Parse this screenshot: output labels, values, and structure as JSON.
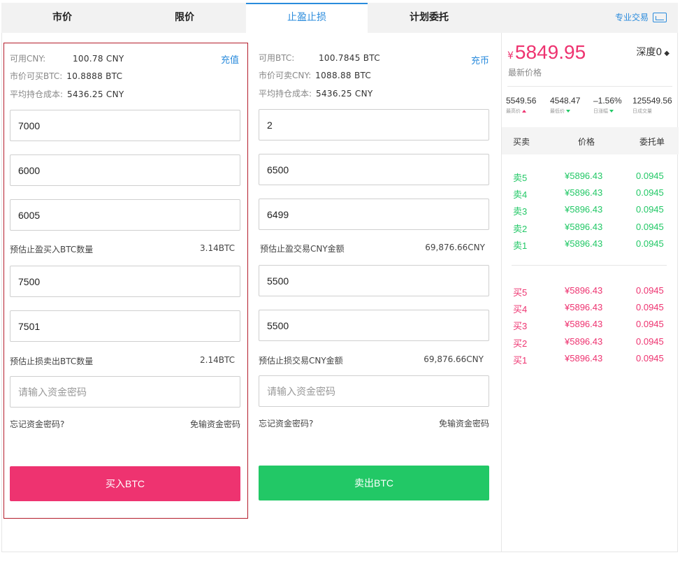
{
  "tabs": [
    {
      "label": "市价"
    },
    {
      "label": "限价"
    },
    {
      "label": "止盈止损"
    },
    {
      "label": "计划委托"
    }
  ],
  "pro_trade_label": "专业交易",
  "buy_panel": {
    "info": [
      {
        "label": "可用CNY:",
        "value": "100.78 CNY"
      },
      {
        "label": "市价可买BTC:",
        "value": "10.8888 BTC"
      },
      {
        "label": "平均持仓成本:",
        "value": "5436.25 CNY"
      }
    ],
    "topup_label": "充值",
    "fields": [
      "7000",
      "6000",
      "6005",
      "7500",
      "7501"
    ],
    "estimate_profit": {
      "label": "预估止盈买入BTC数量",
      "value": "3.14BTC"
    },
    "estimate_loss": {
      "label": "预估止损卖出BTC数量",
      "value": "2.14BTC"
    },
    "password_placeholder": "请输入资金密码",
    "forgot_label": "忘记资金密码?",
    "nopass_label": "免输资金密码",
    "action_label": "买入BTC"
  },
  "sell_panel": {
    "info": [
      {
        "label": "可用BTC:",
        "value": "100.7845 BTC"
      },
      {
        "label": "市价可卖CNY:",
        "value": "1088.88 BTC"
      },
      {
        "label": "平均持仓成本:",
        "value": "5436.25 CNY"
      }
    ],
    "topup_label": "充币",
    "fields": [
      "2",
      "6500",
      "6499",
      "5500",
      "5500"
    ],
    "estimate_profit": {
      "label": "预估止盈交易CNY金额",
      "value": "69,876.66CNY"
    },
    "estimate_loss": {
      "label": "预估止损交易CNY金额",
      "value": "69,876.66CNY"
    },
    "password_placeholder": "请输入资金密码",
    "forgot_label": "忘记资金密码?",
    "nopass_label": "免输资金密码",
    "action_label": "卖出BTC"
  },
  "market": {
    "currency_symbol": "¥",
    "last_price": "5849.95",
    "last_price_label": "最新价格",
    "depth_label": "深度0",
    "depth_arrows": "◆",
    "stats": [
      {
        "value": "5549.56",
        "label": "最高价"
      },
      {
        "value": "4548.47",
        "label": "最低价"
      },
      {
        "value": "–1.56%",
        "label": "日涨幅"
      },
      {
        "value": "125549.56",
        "label": "日成交量"
      }
    ],
    "book_headers": {
      "side": "买卖",
      "price": "价格",
      "qty": "委托单"
    },
    "asks": [
      {
        "side": "卖5",
        "price": "¥5896.43",
        "qty": "0.0945"
      },
      {
        "side": "卖4",
        "price": "¥5896.43",
        "qty": "0.0945"
      },
      {
        "side": "卖3",
        "price": "¥5896.43",
        "qty": "0.0945"
      },
      {
        "side": "卖2",
        "price": "¥5896.43",
        "qty": "0.0945"
      },
      {
        "side": "卖1",
        "price": "¥5896.43",
        "qty": "0.0945"
      }
    ],
    "bids": [
      {
        "side": "买5",
        "price": "¥5896.43",
        "qty": "0.0945"
      },
      {
        "side": "买4",
        "price": "¥5896.43",
        "qty": "0.0945"
      },
      {
        "side": "买3",
        "price": "¥5896.43",
        "qty": "0.0945"
      },
      {
        "side": "买2",
        "price": "¥5896.43",
        "qty": "0.0945"
      },
      {
        "side": "买1",
        "price": "¥5896.43",
        "qty": "0.0945"
      }
    ]
  },
  "colors": {
    "accent": "#2a8bdc",
    "buy": "#ee3370",
    "sell": "#22c866",
    "panel_border": "#b41d2b"
  }
}
